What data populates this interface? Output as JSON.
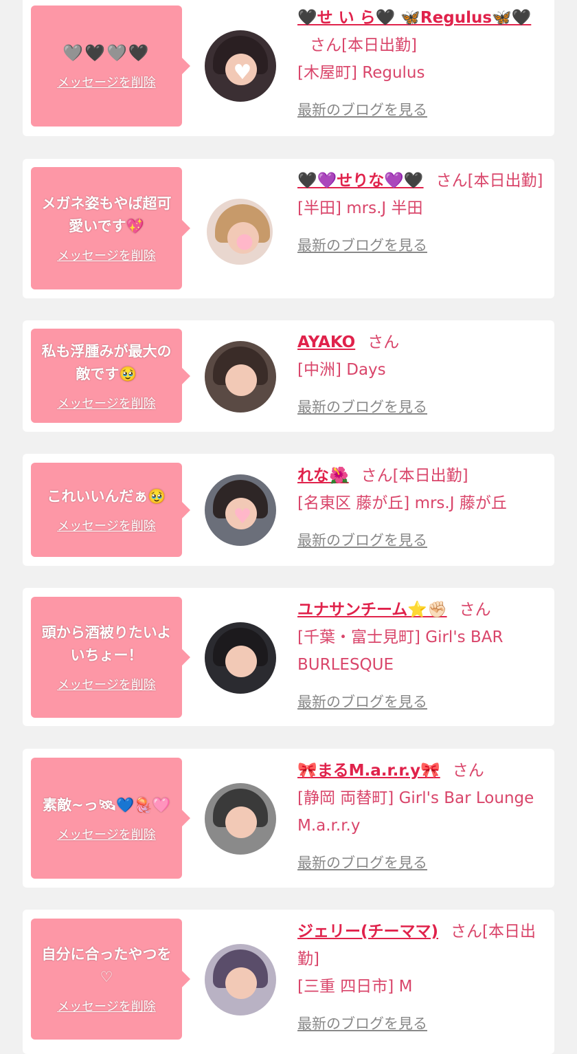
{
  "delete_label": "メッセージを削除",
  "blog_label": "最新のブログを見る",
  "san_suffix": "さん",
  "colors": {
    "bubble": "#fd97a6",
    "name": "#e0224b",
    "text": "#d9456a",
    "link": "#888888",
    "background": "#f1f1f1"
  },
  "cards": [
    {
      "message": "🩶🖤🩶🖤",
      "name": "🖤せ い ら🖤 🦋Regulus🦋🖤",
      "suffix": "さん[本日出勤]",
      "location": "[木屋町] Regulus"
    },
    {
      "message": "メガネ姿もやば超可愛いです💖",
      "name": "🖤💜せりな💜🖤",
      "suffix": "さん[本日出勤]",
      "location": "[半田] mrs.J 半田"
    },
    {
      "message": "私も浮腫みが最大の敵です🥹",
      "name": "AYAKO",
      "suffix": "さん",
      "location": "[中洲] Days"
    },
    {
      "message": "これいいんだぁ🥹",
      "name": "れな🌺",
      "suffix": "さん[本日出勤]",
      "location": "[名東区 藤が丘] mrs.J 藤が丘"
    },
    {
      "message": "頭から酒被りたいよいちょー！",
      "name": "ユナサンチーム⭐✊🏻",
      "suffix": "さん",
      "location": "[千葉・富士見町] Girl's BAR BURLESQUE"
    },
    {
      "message": "素敵~っ🛰💙🪼🩷",
      "name": "🎀まるM.a.r.r.y🎀",
      "suffix": "さん",
      "location": "[静岡 両替町] Girl's Bar Lounge M.a.r.r.y"
    },
    {
      "message": "自分に合ったやつを♡",
      "name": "ジェリー(チーママ)",
      "suffix": "さん[本日出勤]",
      "location": "[三重 四日市] M"
    }
  ]
}
